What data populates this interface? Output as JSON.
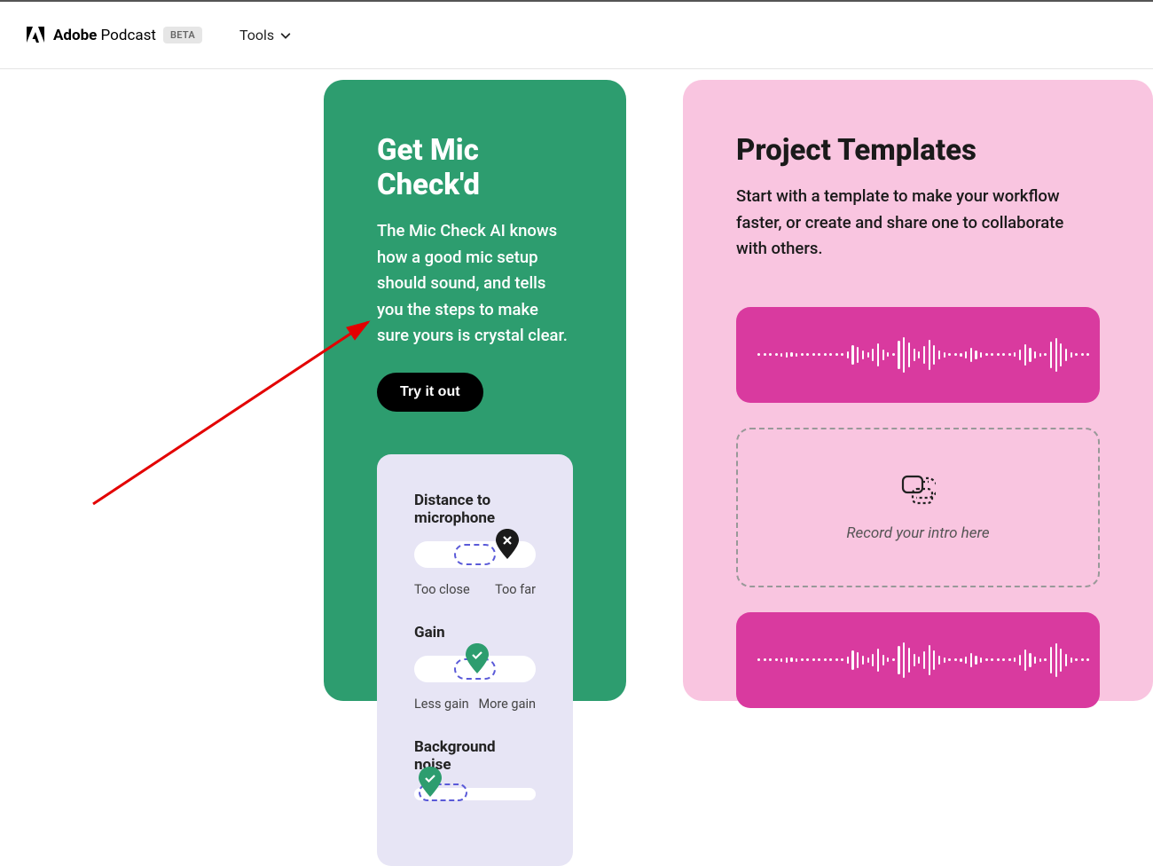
{
  "header": {
    "brand_bold": "Adobe",
    "brand_light": " Podcast",
    "badge": "BETA",
    "tools_label": "Tools"
  },
  "card_green": {
    "title": "Get Mic Check'd",
    "desc": "The Mic Check AI knows how a good mic setup should sound, and tells you the steps to make sure yours is crystal clear.",
    "button": "Try it out",
    "sections": {
      "distance": {
        "label": "Distance to microphone",
        "left": "Too close",
        "right": "Too far"
      },
      "gain": {
        "label": "Gain",
        "left": "Less gain",
        "right": "More gain"
      },
      "noise": {
        "label": "Background noise"
      }
    }
  },
  "card_pink": {
    "title": "Project Templates",
    "desc": "Start with a template to make your workflow faster, or create and share one to collaborate with others.",
    "record_hint": "Record your intro here"
  }
}
